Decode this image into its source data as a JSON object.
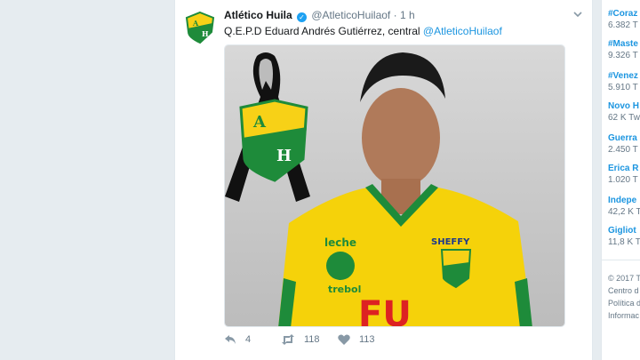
{
  "tweet": {
    "author_name": "Atlético Huila",
    "handle": "@AtleticoHuilaof",
    "separator": "·",
    "time": "1 h",
    "text": "Q.E.P.D Eduard Andrés Gutiérrez, central",
    "mention": "@AtleticoHuilaof",
    "replies": "4",
    "retweets": "118",
    "likes": "113",
    "image": {
      "crest_letter_top": "A",
      "crest_letter_bottom": "H",
      "shirt_sponsor_left": "leche",
      "shirt_sponsor_left_sub": "trebol",
      "shirt_brand": "SHEFFY",
      "shirt_front_text": "FU"
    }
  },
  "trends": [
    {
      "title": "#Coraz",
      "count": "6.382 T"
    },
    {
      "title": "#Maste",
      "count": "9.326 T"
    },
    {
      "title": "#Venez",
      "count": "5.910 T"
    },
    {
      "title": "Novo H",
      "count": "62 K Tw"
    },
    {
      "title": "Guerra",
      "count": "2.450 T"
    },
    {
      "title": "Erica R",
      "count": "1.020 T"
    },
    {
      "title": "Indepe",
      "count": "42,2 K T"
    },
    {
      "title": "Gigliot",
      "count": "11,8 K T"
    }
  ],
  "footer": [
    "© 2017 T",
    "Centro d",
    "Política d",
    "Informac"
  ],
  "colors": {
    "accent": "#1b95e0",
    "crest_yellow": "#f7d117",
    "crest_green": "#1e8b3a"
  }
}
